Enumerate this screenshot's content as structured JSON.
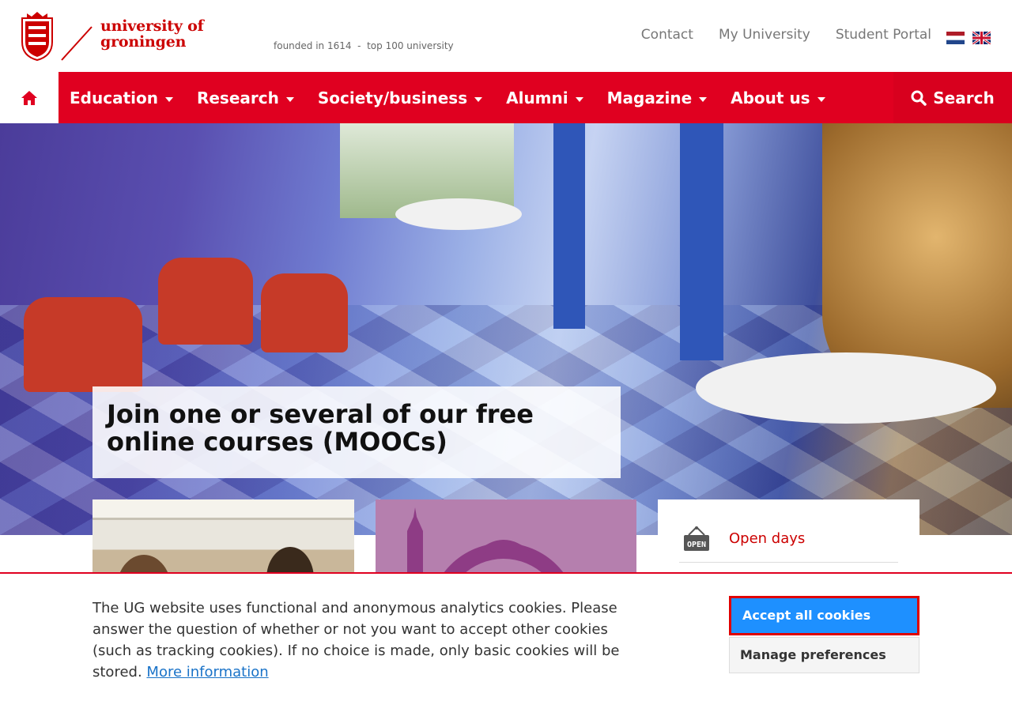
{
  "header": {
    "logo_text_line1": "university of",
    "logo_text_line2": "groningen",
    "tagline": "founded in 1614  -  top 100 university",
    "top_links": [
      "Contact",
      "My University",
      "Student Portal"
    ],
    "languages": [
      "nl-flag-icon",
      "uk-flag-icon"
    ]
  },
  "nav": {
    "home_icon": "home-icon",
    "items": [
      "Education",
      "Research",
      "Society/business",
      "Alumni",
      "Magazine",
      "About us"
    ],
    "search_label": "Search",
    "search_icon": "search-icon"
  },
  "hero": {
    "caption": "Join one or several of our free online courses (MOOCs)"
  },
  "cards": {
    "links": [
      {
        "label": "Open days",
        "icon": "open-sign-icon"
      }
    ]
  },
  "cookie_banner": {
    "text": "The UG website uses functional and anonymous analytics cookies. Please answer the question of whether or not you want to accept other cookies (such as tracking cookies). If no choice is made, only basic cookies will be stored.",
    "more_info": "More information",
    "accept_label": "Accept all cookies",
    "manage_label": "Manage preferences"
  },
  "colors": {
    "brand_red": "#e00020",
    "accept_blue": "#1e90ff",
    "link_blue": "#1a73c8"
  }
}
